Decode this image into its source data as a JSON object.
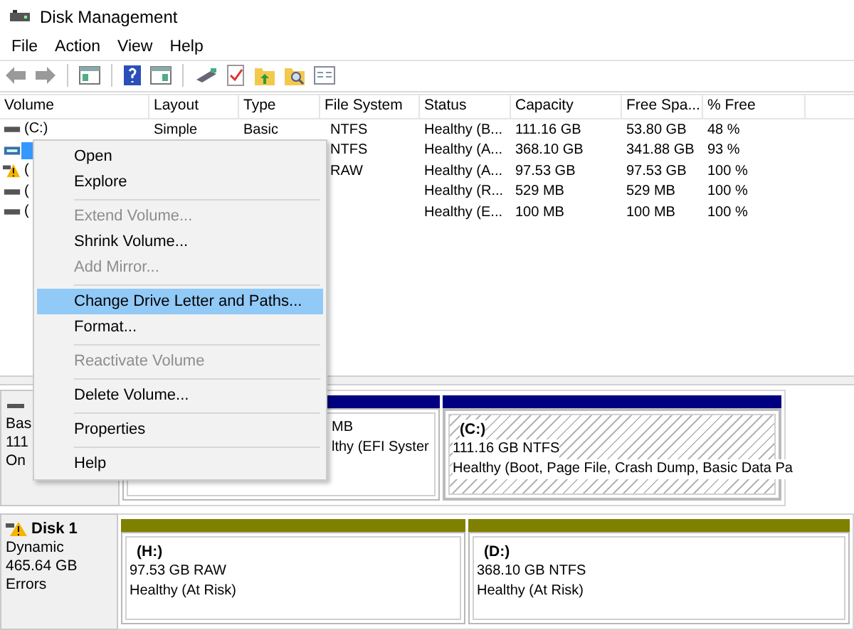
{
  "window": {
    "title": "Disk Management"
  },
  "menu_bar": [
    "File",
    "Action",
    "View",
    "Help"
  ],
  "table": {
    "columns": [
      "Volume",
      "Layout",
      "Type",
      "File System",
      "Status",
      "Capacity",
      "Free Spa...",
      "% Free"
    ],
    "rows": [
      {
        "kind": "basic",
        "selected": false,
        "volume": "(C:)",
        "layout": "Simple",
        "type": "Basic",
        "file_system": "NTFS",
        "status": "Healthy (B...",
        "capacity": "111.16 GB",
        "free_space": "53.80 GB",
        "percent_free": "48 %"
      },
      {
        "kind": "dynamic",
        "selected": true,
        "file_system": "NTFS",
        "status": "Healthy (A...",
        "capacity": "368.10 GB",
        "free_space": "341.88 GB",
        "percent_free": "93 %"
      },
      {
        "kind": "at_risk",
        "selected": false,
        "volume": "(",
        "file_system": "RAW",
        "status": "Healthy (A...",
        "capacity": "97.53 GB",
        "free_space": "97.53 GB",
        "percent_free": "100 %"
      },
      {
        "kind": "basic",
        "selected": false,
        "volume": "(",
        "status": "Healthy (R...",
        "capacity": "529 MB",
        "free_space": "529 MB",
        "percent_free": "100 %"
      },
      {
        "kind": "basic",
        "selected": false,
        "volume": "(",
        "status": "Healthy (E...",
        "capacity": "100 MB",
        "free_space": "100 MB",
        "percent_free": "100 %"
      }
    ]
  },
  "context_menu": [
    {
      "kind": "item",
      "label": "Open",
      "disabled": false,
      "selected": false
    },
    {
      "kind": "item",
      "label": "Explore",
      "disabled": false,
      "selected": false
    },
    {
      "kind": "separator"
    },
    {
      "kind": "item",
      "label": "Extend Volume...",
      "disabled": true,
      "selected": false
    },
    {
      "kind": "item",
      "label": "Shrink Volume...",
      "disabled": false,
      "selected": false
    },
    {
      "kind": "item",
      "label": "Add Mirror...",
      "disabled": true,
      "selected": false
    },
    {
      "kind": "separator"
    },
    {
      "kind": "item",
      "label": "Change Drive Letter and Paths...",
      "disabled": false,
      "selected": true
    },
    {
      "kind": "item",
      "label": "Format...",
      "disabled": false,
      "selected": false
    },
    {
      "kind": "separator"
    },
    {
      "kind": "item",
      "label": "Reactivate Volume",
      "disabled": true,
      "selected": false
    },
    {
      "kind": "separator"
    },
    {
      "kind": "item",
      "label": "Delete Volume...",
      "disabled": false,
      "selected": false
    },
    {
      "kind": "separator"
    },
    {
      "kind": "item",
      "label": "Properties",
      "disabled": false,
      "selected": false
    },
    {
      "kind": "separator"
    },
    {
      "kind": "item",
      "label": "Help",
      "disabled": false,
      "selected": false
    }
  ],
  "disks": [
    {
      "kind": "basic",
      "lines": [
        "Bas",
        "111",
        "On"
      ],
      "partitions": [
        {
          "selected": false,
          "lines": [
            "MB",
            "lthy (EFI Syster"
          ]
        },
        {
          "selected": true,
          "name": "(C:)",
          "lines": [
            "111.16 GB NTFS",
            "Healthy (Boot, Page File, Crash Dump, Basic Data Pa"
          ]
        }
      ]
    },
    {
      "kind": "dynamic",
      "name": "Disk 1",
      "lines": [
        "Dynamic",
        "465.64 GB",
        "Errors"
      ],
      "partitions": [
        {
          "selected": false,
          "name": "(H:)",
          "lines": [
            "97.53 GB RAW",
            "Healthy (At Risk)"
          ]
        },
        {
          "selected": false,
          "name": "(D:)",
          "lines": [
            "368.10 GB NTFS",
            "Healthy (At Risk)"
          ]
        }
      ]
    }
  ]
}
